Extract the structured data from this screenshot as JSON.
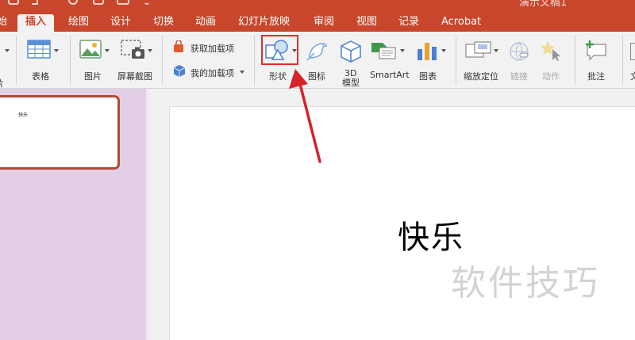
{
  "window": {
    "doc_title": "演示文稿1",
    "quick_access_icons": [
      "home-icon",
      "undo-icon",
      "redo-icon",
      "save-icon",
      "print-icon",
      "more-icon"
    ]
  },
  "tabs": [
    {
      "label": "始",
      "active": false
    },
    {
      "label": "插入",
      "active": true
    },
    {
      "label": "绘图",
      "active": false
    },
    {
      "label": "设计",
      "active": false
    },
    {
      "label": "切换",
      "active": false
    },
    {
      "label": "动画",
      "active": false
    },
    {
      "label": "幻灯片放映",
      "active": false
    },
    {
      "label": "审阅",
      "active": false
    },
    {
      "label": "视图",
      "active": false
    },
    {
      "label": "记录",
      "active": false
    },
    {
      "label": "Acrobat",
      "active": false
    }
  ],
  "ribbon": {
    "left_group_label": "片",
    "table": "表格",
    "picture": "图片",
    "screenshot": "屏幕截图",
    "get_addins": "获取加载项",
    "my_addins": "我的加载项",
    "shapes": "形状",
    "icons": "图标",
    "model3d_line1": "3D",
    "model3d_line2": "模型",
    "smartart": "SmartArt",
    "chart": "图表",
    "zoom": "缩放定位",
    "link": "链接",
    "action": "动作",
    "comment": "批注",
    "right_cut": "文"
  },
  "thumbnail": {
    "text": "快乐"
  },
  "slide": {
    "text": "快乐"
  },
  "watermark": {
    "text": "软件技巧"
  },
  "colors": {
    "accent": "#c8472c",
    "thumb_pane": "#e2cfe6",
    "highlight_box": "#d6332a",
    "arrow": "#d8222a"
  }
}
